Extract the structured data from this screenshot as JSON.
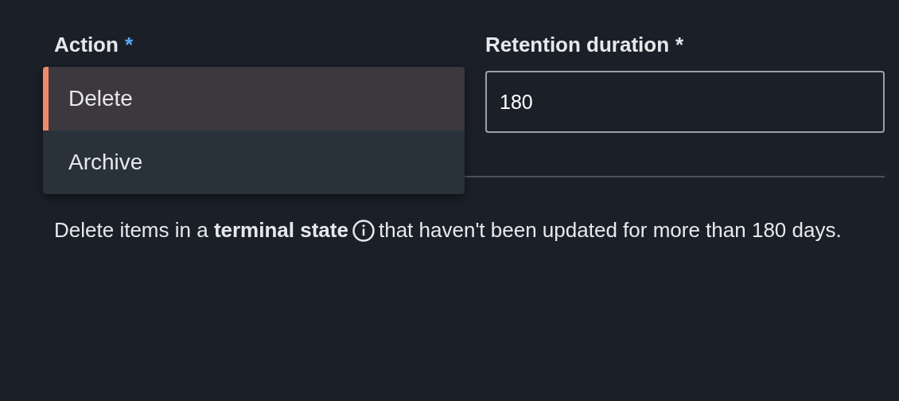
{
  "action": {
    "label": "Action",
    "required_mark": "*",
    "focused": true,
    "options": [
      {
        "label": "Delete",
        "selected": true
      },
      {
        "label": "Archive",
        "selected": false
      }
    ]
  },
  "retention": {
    "label": "Retention duration",
    "required_mark": "*",
    "focused": false,
    "value": "180"
  },
  "description": {
    "before_icon": "Delete items in a **terminal state**",
    "after_icon": "that haven't been updated for more than 180 days."
  }
}
